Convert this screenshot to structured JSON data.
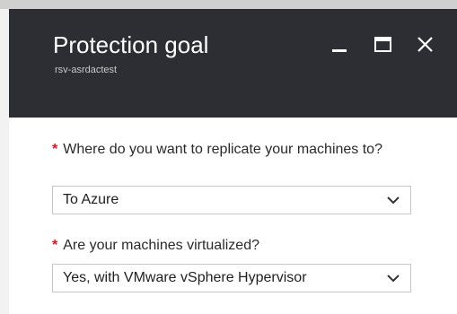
{
  "blade": {
    "title": "Protection goal",
    "subtitle": "rsv-asrdactest",
    "controls": [
      "minimize-icon",
      "maximize-icon",
      "close-icon"
    ]
  },
  "form": {
    "question1": {
      "required_marker": "*",
      "label": "Where do you want to replicate your machines to?",
      "selected": "To Azure"
    },
    "question2": {
      "required_marker": "*",
      "label": "Are your machines virtualized?",
      "selected": "Yes, with VMware vSphere Hypervisor"
    }
  },
  "colors": {
    "header_bg": "#2c2e33",
    "required": "#e81123"
  }
}
